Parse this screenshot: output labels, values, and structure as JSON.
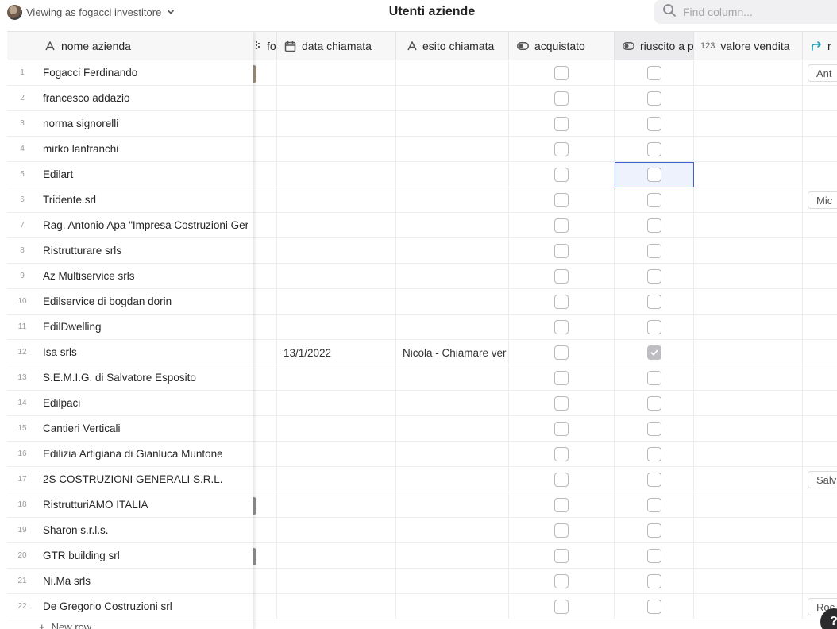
{
  "topbar": {
    "viewing_label": "Viewing as fogacci investitore",
    "title": "Utenti aziende",
    "search_placeholder": "Find column..."
  },
  "columns": {
    "nome_azienda": "nome azienda",
    "foto": "fot",
    "data_chiamata": "data chiamata",
    "esito_chiamata": "esito chiamata",
    "acquistato": "acquistato",
    "riuscito": "riuscito a p",
    "valore_vendita": "valore vendita",
    "number_icon": "123",
    "last": "r"
  },
  "rows": [
    {
      "n": "1",
      "name": "Fogacci Ferdinando",
      "data": "",
      "esito": "",
      "acq": false,
      "riu": false,
      "chip": "Ant",
      "thumb": "brown"
    },
    {
      "n": "2",
      "name": "francesco addazio",
      "data": "",
      "esito": "",
      "acq": false,
      "riu": false,
      "chip": "",
      "thumb": ""
    },
    {
      "n": "3",
      "name": "norma signorelli",
      "data": "",
      "esito": "",
      "acq": false,
      "riu": false,
      "chip": "",
      "thumb": ""
    },
    {
      "n": "4",
      "name": "mirko lanfranchi",
      "data": "",
      "esito": "",
      "acq": false,
      "riu": false,
      "chip": "",
      "thumb": ""
    },
    {
      "n": "5",
      "name": "Edilart",
      "data": "",
      "esito": "",
      "acq": false,
      "riu": false,
      "chip": "",
      "thumb": ""
    },
    {
      "n": "6",
      "name": "Tridente srl",
      "data": "",
      "esito": "",
      "acq": false,
      "riu": false,
      "chip": "Mic",
      "thumb": ""
    },
    {
      "n": "7",
      "name": "Rag. Antonio Apa \"Impresa Costruzioni Ger",
      "data": "",
      "esito": "",
      "acq": false,
      "riu": false,
      "chip": "",
      "thumb": ""
    },
    {
      "n": "8",
      "name": "Ristrutturare srls",
      "data": "",
      "esito": "",
      "acq": false,
      "riu": false,
      "chip": "",
      "thumb": ""
    },
    {
      "n": "9",
      "name": "Az Multiservice srls",
      "data": "",
      "esito": "",
      "acq": false,
      "riu": false,
      "chip": "",
      "thumb": ""
    },
    {
      "n": "10",
      "name": "Edilservice di bogdan dorin",
      "data": "",
      "esito": "",
      "acq": false,
      "riu": false,
      "chip": "",
      "thumb": ""
    },
    {
      "n": "11",
      "name": "EdilDwelling",
      "data": "",
      "esito": "",
      "acq": false,
      "riu": false,
      "chip": "",
      "thumb": ""
    },
    {
      "n": "12",
      "name": "Isa srls",
      "data": "13/1/2022",
      "esito": "Nicola - Chiamare ver",
      "acq": false,
      "riu": true,
      "chip": "",
      "thumb": ""
    },
    {
      "n": "13",
      "name": "S.E.M.I.G. di Salvatore Esposito",
      "data": "",
      "esito": "",
      "acq": false,
      "riu": false,
      "chip": "",
      "thumb": ""
    },
    {
      "n": "14",
      "name": "Edilpaci",
      "data": "",
      "esito": "",
      "acq": false,
      "riu": false,
      "chip": "",
      "thumb": ""
    },
    {
      "n": "15",
      "name": "Cantieri Verticali",
      "data": "",
      "esito": "",
      "acq": false,
      "riu": false,
      "chip": "",
      "thumb": ""
    },
    {
      "n": "16",
      "name": "Edilizia Artigiana di Gianluca Muntone",
      "data": "",
      "esito": "",
      "acq": false,
      "riu": false,
      "chip": "",
      "thumb": ""
    },
    {
      "n": "17",
      "name": "2S COSTRUZIONI GENERALI S.R.L.",
      "data": "",
      "esito": "",
      "acq": false,
      "riu": false,
      "chip": "Salv",
      "thumb": ""
    },
    {
      "n": "18",
      "name": "RistrutturiAMO ITALIA",
      "data": "",
      "esito": "",
      "acq": false,
      "riu": false,
      "chip": "",
      "thumb": "gray"
    },
    {
      "n": "19",
      "name": "Sharon s.r.l.s.",
      "data": "",
      "esito": "",
      "acq": false,
      "riu": false,
      "chip": "",
      "thumb": ""
    },
    {
      "n": "20",
      "name": "GTR building srl",
      "data": "",
      "esito": "",
      "acq": false,
      "riu": false,
      "chip": "",
      "thumb": "gray"
    },
    {
      "n": "21",
      "name": "Ni.Ma srls",
      "data": "",
      "esito": "",
      "acq": false,
      "riu": false,
      "chip": "",
      "thumb": ""
    },
    {
      "n": "22",
      "name": "De Gregorio Costruzioni srl",
      "data": "",
      "esito": "",
      "acq": false,
      "riu": false,
      "chip": "Roc",
      "thumb": ""
    }
  ],
  "new_row_label": "New row",
  "help_label": "?"
}
